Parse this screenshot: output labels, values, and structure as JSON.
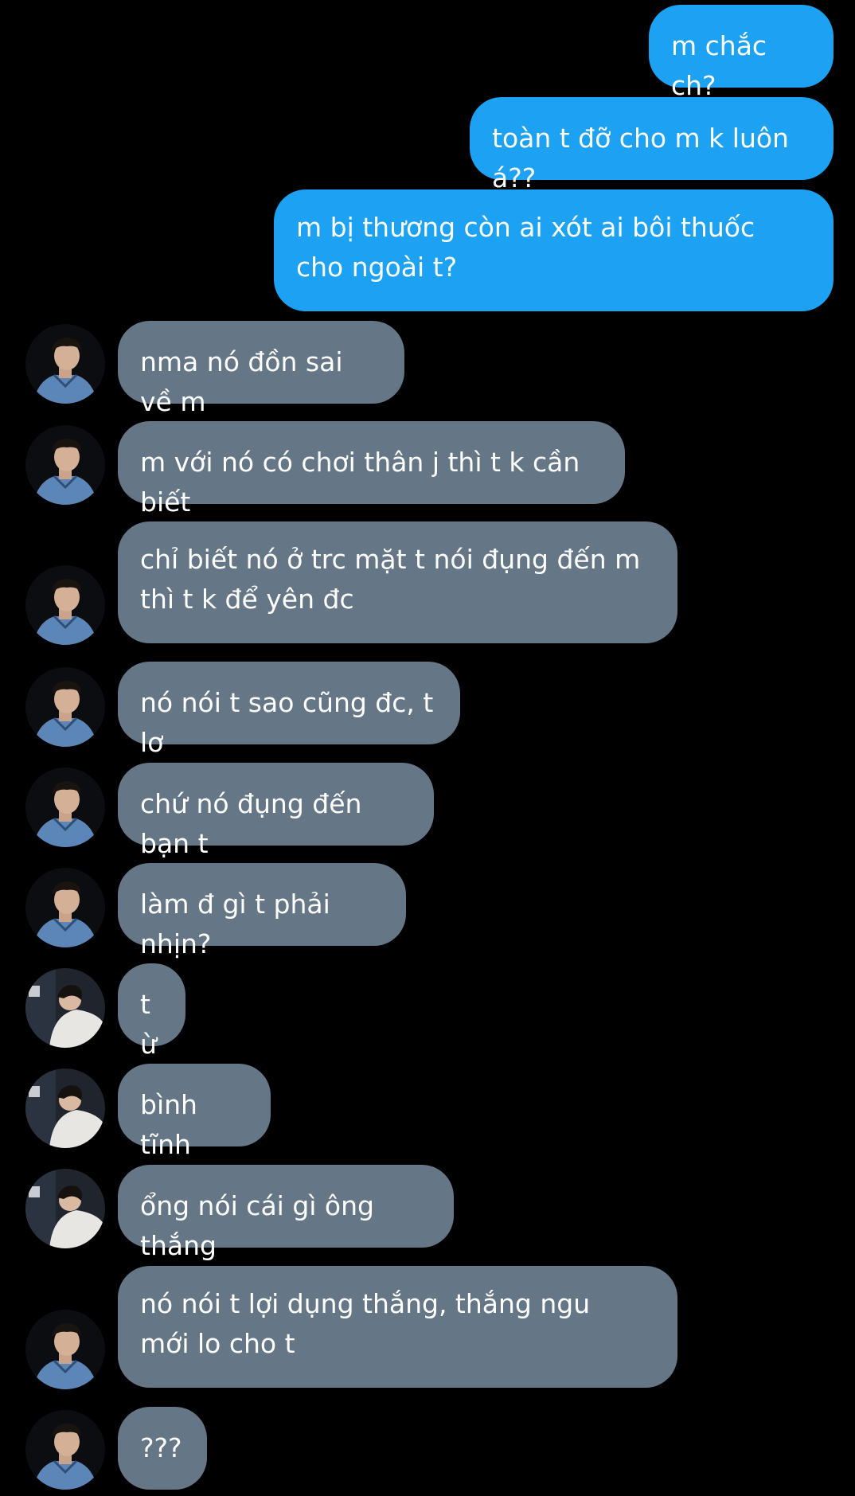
{
  "colors": {
    "background": "#000000",
    "outgoing": "#1da1f2",
    "incoming": "#657786",
    "text": "#ffffff"
  },
  "avatars": {
    "a": "avatar-blue-shirt",
    "b": "avatar-white-shirt"
  },
  "messages": [
    {
      "side": "out",
      "text": "m chắc ch?"
    },
    {
      "side": "out",
      "text": "toàn t đỡ cho m k luôn á??"
    },
    {
      "side": "out",
      "text": "m bị thương còn ai xót ai bôi thuốc cho ngoài t?"
    },
    {
      "side": "in",
      "avatar": "a",
      "text": "nma nó đồn sai về m"
    },
    {
      "side": "in",
      "avatar": "a",
      "text": "m với nó có chơi thân j thì t k cần biết"
    },
    {
      "side": "in",
      "avatar": "a",
      "text": "chỉ biết nó ở trc mặt t nói đụng đến m thì t k để yên đc"
    },
    {
      "side": "in",
      "avatar": "a",
      "text": "nó nói t sao cũng đc, t lơ"
    },
    {
      "side": "in",
      "avatar": "a",
      "text": "chứ nó đụng đến bạn t"
    },
    {
      "side": "in",
      "avatar": "a",
      "text": "làm đ gì t phải nhịn?"
    },
    {
      "side": "in",
      "avatar": "b",
      "text": "từ"
    },
    {
      "side": "in",
      "avatar": "b",
      "text": "bình tĩnh"
    },
    {
      "side": "in",
      "avatar": "b",
      "text": "ổng nói cái gì ông thắng"
    },
    {
      "side": "in",
      "avatar": "a",
      "text": "nó nói t lợi dụng thắng, thắng ngu mới lo cho t"
    },
    {
      "side": "in",
      "avatar": "a",
      "text": "???"
    }
  ]
}
